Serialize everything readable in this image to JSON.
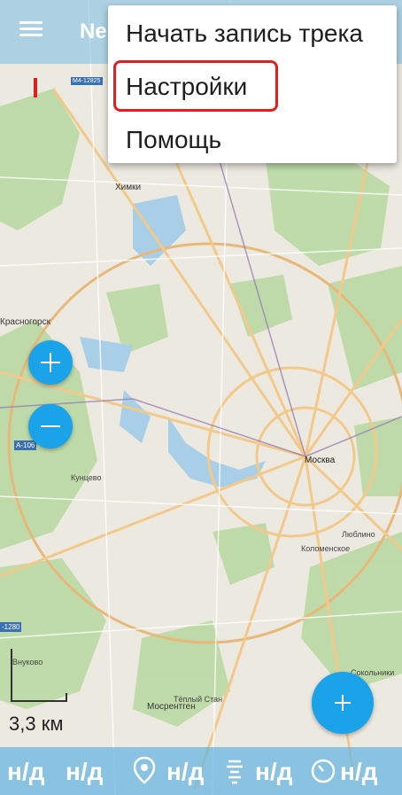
{
  "app_bar": {
    "title": "Ne",
    "menu_icon": "hamburger-menu-icon"
  },
  "dropdown_menu": {
    "items": [
      {
        "label": "Начать запись трека"
      },
      {
        "label": "Настройки",
        "highlighted": true
      },
      {
        "label": "Помощь"
      }
    ]
  },
  "map": {
    "labels": {
      "himki": "Химки",
      "krasnogorsk": "Красногорск",
      "moscow": "Москва",
      "vnukovo": "Внуково",
      "kuntsevo": "Кунцево",
      "sokolniki": "Сокольники",
      "mosrentgen": "Мосрентген",
      "lyublino": "Люблино",
      "teply_stan": "Тёплый Стан",
      "kolomenskoe": "Коломенское",
      "highway_badge": "М4-12825",
      "road_a106": "А-106",
      "road_1280": "-1280"
    }
  },
  "controls": {
    "zoom_in_icon": "plus-icon",
    "zoom_out_icon": "minus-icon",
    "fab_icon": "plus-icon"
  },
  "scale": {
    "label": "3,3 км"
  },
  "status_bar": {
    "values": [
      "н/д",
      "н/д",
      "н/д",
      "н/д",
      "н/д"
    ],
    "icons": [
      "location-pin-icon",
      "altitude-icon",
      "speedometer-icon"
    ]
  },
  "colors": {
    "accent": "#1aa3e8",
    "highlight": "#e02020",
    "bar_overlay": "#64b4e1"
  }
}
